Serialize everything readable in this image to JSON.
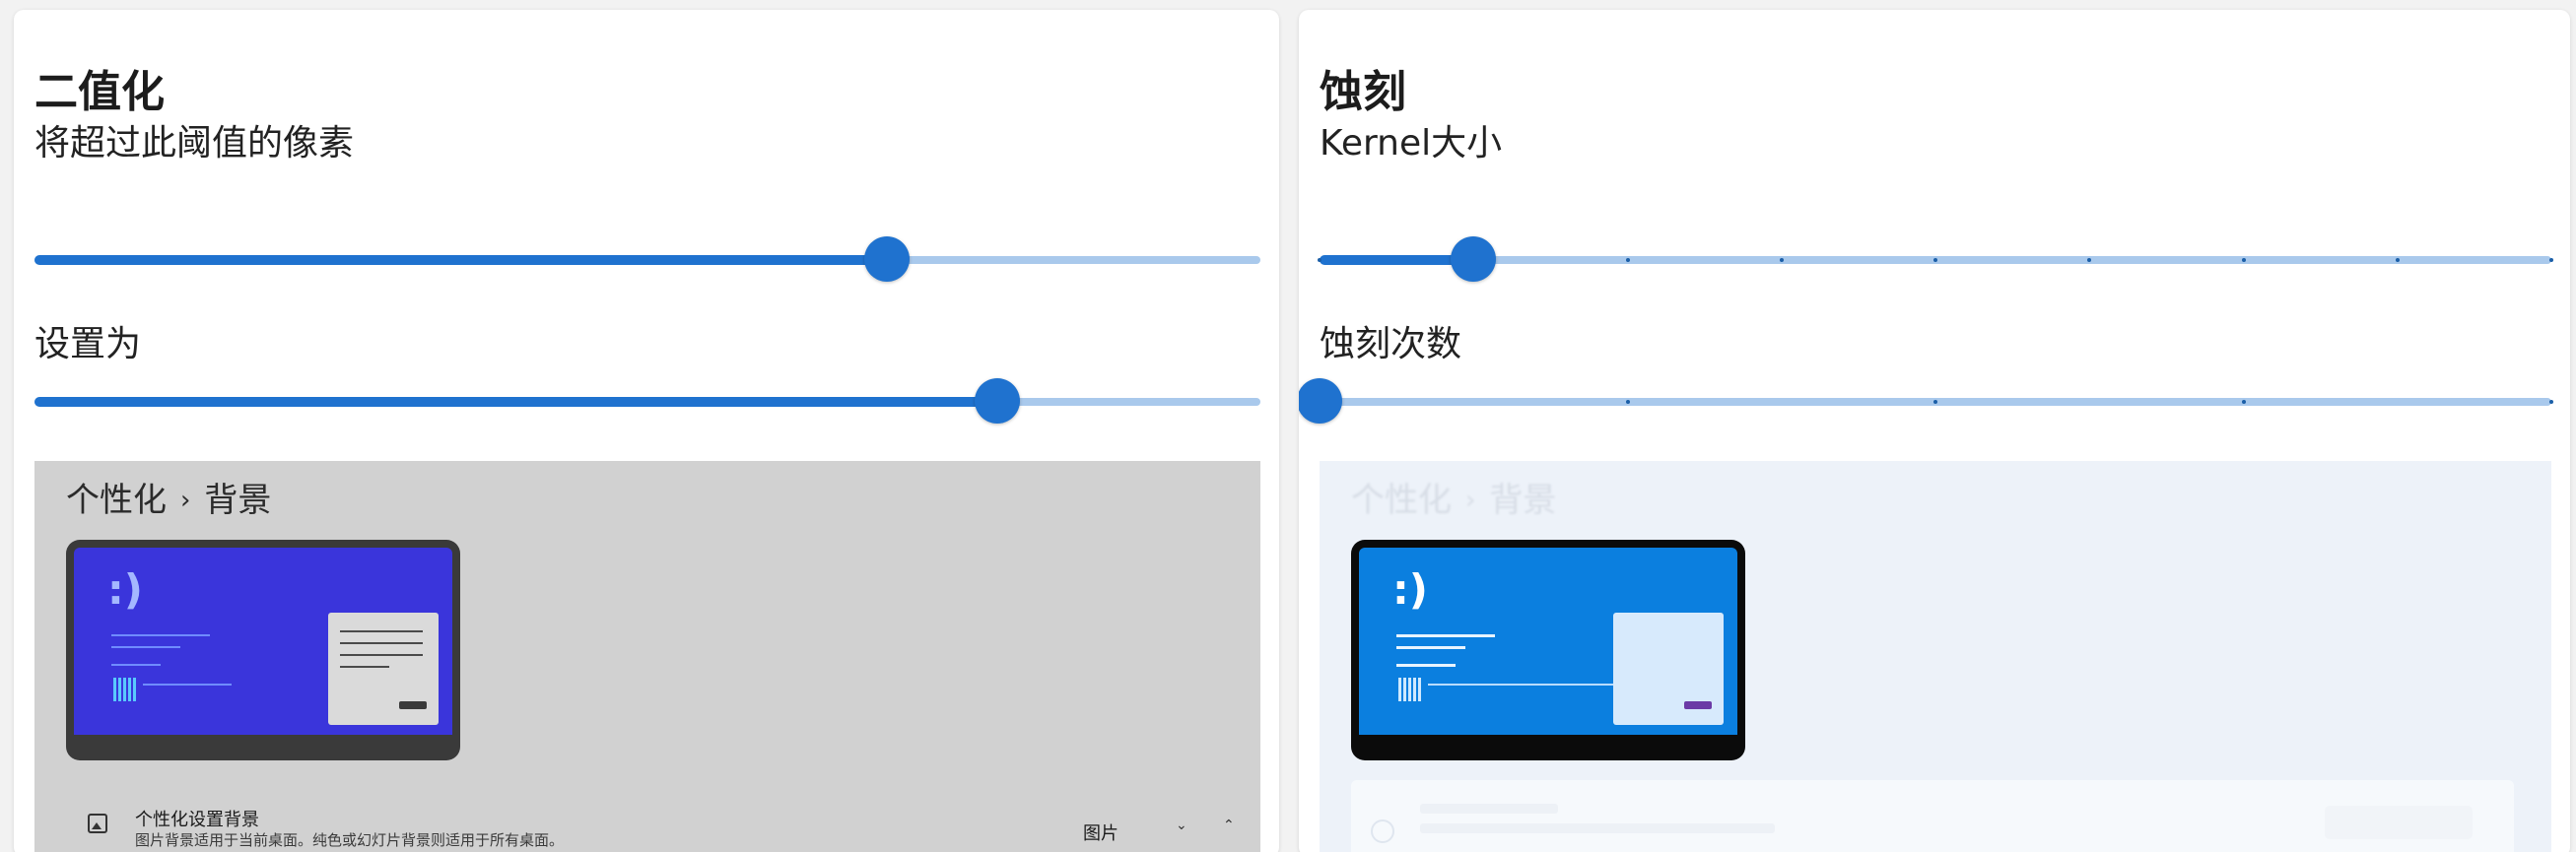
{
  "binarize": {
    "title": "二值化",
    "threshold_label": "将超过此阈值的像素",
    "threshold_value": 0.695,
    "set_label": "设置为",
    "set_value": 0.785
  },
  "erode": {
    "title": "蚀刻",
    "kernel_label": "Kernel大小",
    "kernel_value": 0.125,
    "kernel_ticks": 9,
    "iterations_label": "蚀刻次数",
    "iterations_value": 0.0,
    "iterations_ticks": 5
  },
  "preview": {
    "breadcrumb_parent": "个性化",
    "breadcrumb_separator": "›",
    "breadcrumb_current": "背景",
    "smiley": ":)",
    "setting_title": "个性化设置背景",
    "setting_subtitle": "图片背景适用于当前桌面。纯色或幻灯片背景则适用于所有桌面。",
    "setting_value": "图片",
    "chevron_down": "⌄",
    "chevron_up": "⌃"
  },
  "colors": {
    "accent": "#1f72cf",
    "track": "#a9c9ec",
    "gray_preview_bg": "#d1d1d1",
    "light_preview_bg": "#edf2f9"
  }
}
